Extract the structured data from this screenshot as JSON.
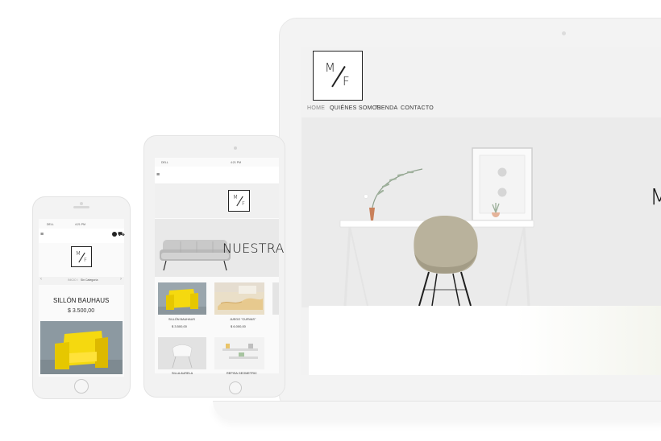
{
  "laptop": {
    "logo": {
      "line1": "M",
      "line2": "F"
    },
    "nav": [
      {
        "label": "HOME",
        "active": true
      },
      {
        "label": "QUIÉNES SOMOS",
        "active": false
      },
      {
        "label": "TIENDA",
        "active": false
      },
      {
        "label": "CONTACTO",
        "active": false
      }
    ],
    "hero_partial_text": "M"
  },
  "tablet": {
    "status": {
      "carrier": "DELL",
      "time": "4:21 PM"
    },
    "logo": {
      "line1": "M",
      "line2": "F"
    },
    "hero_text": "NUESTRA",
    "products": [
      {
        "name": "SILLÓN BAUHAUS",
        "price": "$ 3.500,00"
      },
      {
        "name": "JUEGO \"CURVAS\"",
        "price": "$ 6.000,00"
      },
      {
        "name": "SILLA AURELA",
        "price": ""
      },
      {
        "name": "REPISA GEOMETRIC",
        "price": ""
      }
    ]
  },
  "phone": {
    "status": {
      "carrier": "DELL",
      "time": "4:21 PM"
    },
    "logo": {
      "line1": "M",
      "line2": "F"
    },
    "breadcrumb": {
      "home": "INICIO",
      "sep": "/",
      "category": "Sin Categoría"
    },
    "product": {
      "name": "SILLÓN BAUHAUS",
      "price": "$ 3.500,00"
    }
  },
  "colors": {
    "accent_yellow": "#f5d90f",
    "nav_active": "#888888",
    "text": "#222222"
  }
}
